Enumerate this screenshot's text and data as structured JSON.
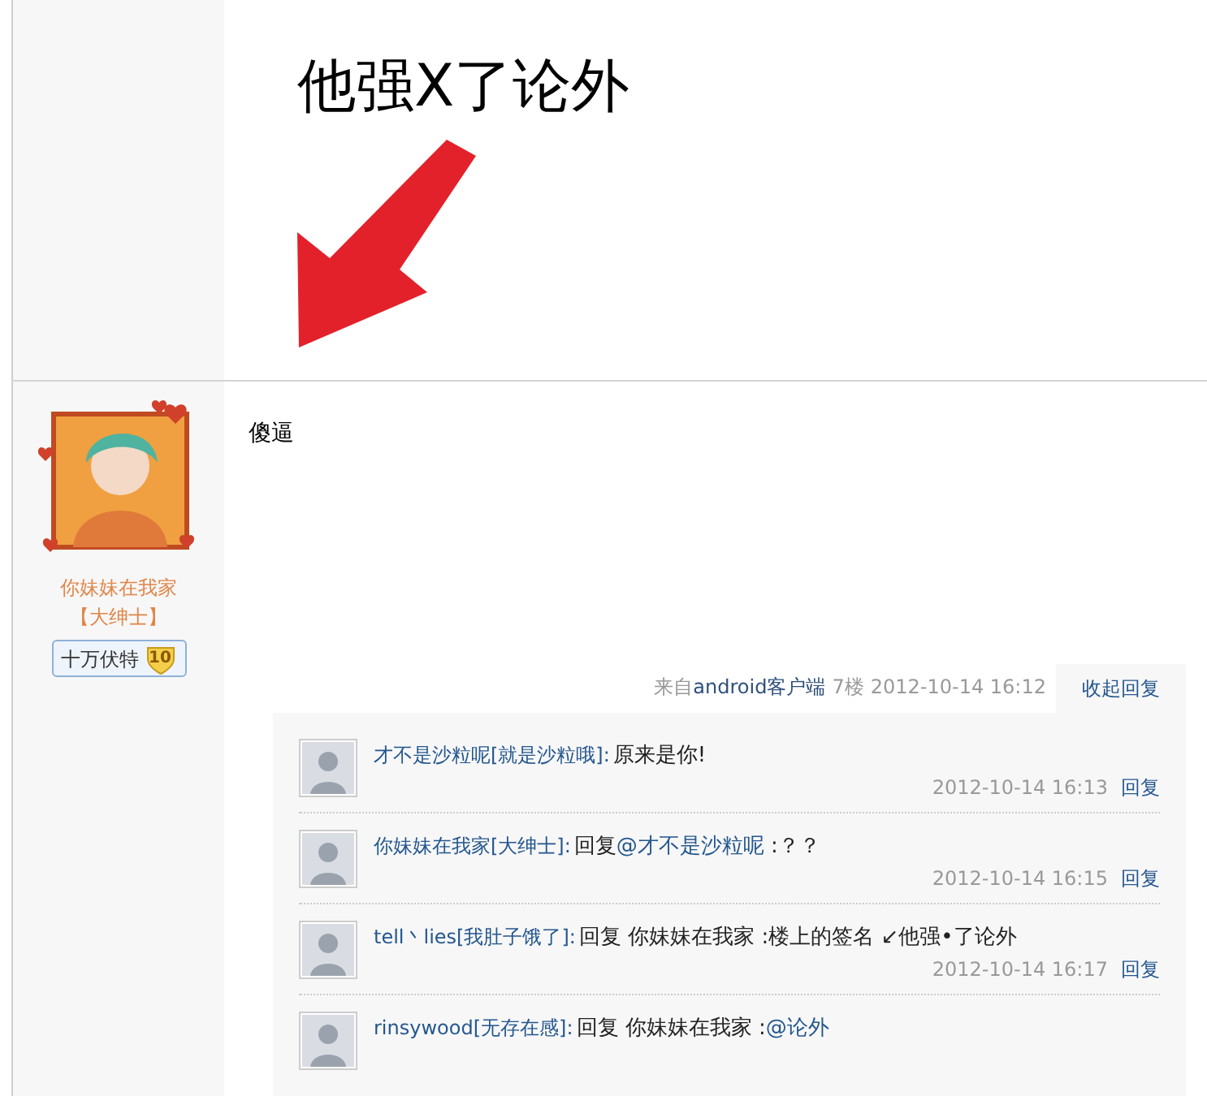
{
  "top_post": {
    "signature_text": "他强X了论外"
  },
  "post": {
    "author": {
      "name": "你妹妹在我家",
      "title": "【大绅士】",
      "badge": {
        "label": "十万伏特",
        "level": "10"
      }
    },
    "content": "傻逼",
    "meta": {
      "source_prefix": "来自",
      "source": "android客户端",
      "floor": "7楼",
      "time": "2012-10-14 16:12"
    },
    "collapse_button": "收起回复",
    "replies": [
      {
        "author": "才不是沙粒呢[就是沙粒哦]:",
        "segments": [
          {
            "text": "原来是你!",
            "link": false
          }
        ],
        "time": "2012-10-14 16:13",
        "reply_link": "回复"
      },
      {
        "author": "你妹妹在我家[大绅士]:",
        "segments": [
          {
            "text": "回复",
            "link": false
          },
          {
            "text": "@才不是沙粒呢",
            "link": true
          },
          {
            "text": " :？？",
            "link": false
          }
        ],
        "time": "2012-10-14 16:15",
        "reply_link": "回复"
      },
      {
        "author": "tell丶lies[我肚子饿了]:",
        "segments": [
          {
            "text": "回复 你妹妹在我家 :楼上的签名 ↙他强•了论外",
            "link": false
          }
        ],
        "time": "2012-10-14 16:17",
        "reply_link": "回复"
      },
      {
        "author": "rinsywood[无存在感]:",
        "segments": [
          {
            "text": "回复 你妹妹在我家 :",
            "link": false
          },
          {
            "text": "@论外",
            "link": true
          }
        ]
      }
    ]
  }
}
